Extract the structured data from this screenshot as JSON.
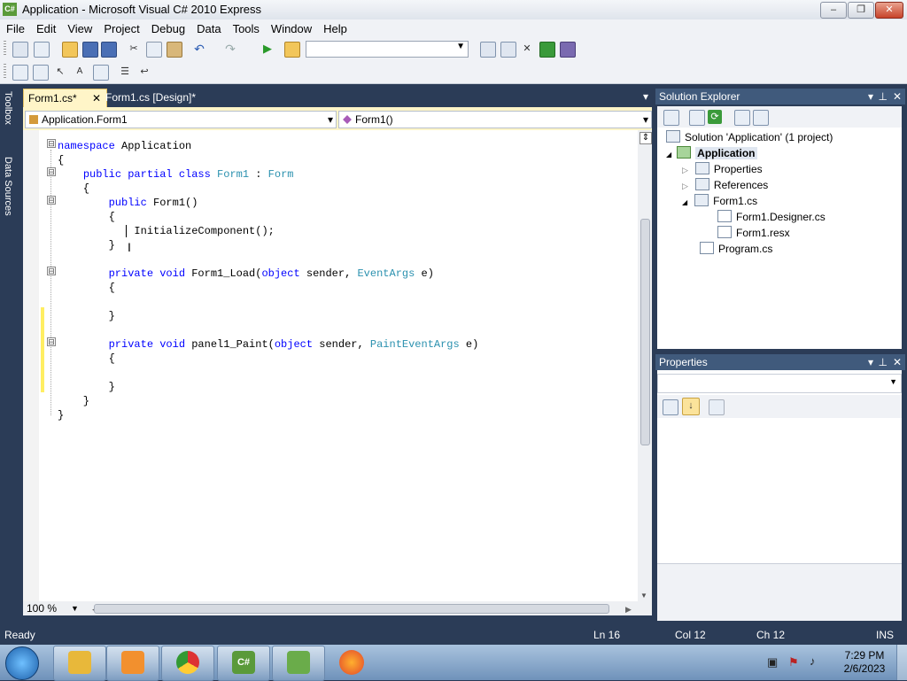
{
  "window": {
    "title": "Application - Microsoft Visual C# 2010 Express",
    "app_icon": "C#",
    "minimize": "–",
    "maximize": "❐",
    "close": "✕"
  },
  "menu": [
    "File",
    "Edit",
    "View",
    "Project",
    "Debug",
    "Data",
    "Tools",
    "Window",
    "Help"
  ],
  "toolbox_tabs": {
    "toolbox": "Toolbox",
    "data_sources": "Data Sources"
  },
  "tabs": [
    {
      "label": "Form1.cs*",
      "close": "✕"
    },
    {
      "label": "Form1.cs [Design]*"
    }
  ],
  "tab_dropdown": "▾",
  "nav": {
    "type_dropdown": "Application.Form1",
    "member_dropdown": "Form1()",
    "arrow": "▾"
  },
  "code_lines": [
    "namespace Application",
    "{",
    "    public partial class Form1 : Form",
    "    {",
    "        public Form1()",
    "        {",
    "            InitializeComponent();",
    "        }",
    "",
    "        private void Form1_Load(object sender, EventArgs e)",
    "        {",
    "",
    "        }",
    "",
    "        private void panel1_Paint(object sender, PaintEventArgs e)",
    "        {",
    "",
    "        }",
    "    }",
    "}"
  ],
  "fold_marks": "⊟",
  "zoom": "100 %",
  "solution_explorer": {
    "title": "Solution Explorer",
    "tree": [
      {
        "label": "Solution 'Application' (1 project)",
        "icon": "solution-icon"
      },
      {
        "label": "Application",
        "icon": "csharp-project-icon",
        "bold": true
      },
      {
        "label": "Properties",
        "icon": "properties-folder-icon"
      },
      {
        "label": "References",
        "icon": "references-folder-icon"
      },
      {
        "label": "Form1.cs",
        "icon": "form-file-icon"
      },
      {
        "label": "Form1.Designer.cs",
        "icon": "cs-file-icon"
      },
      {
        "label": "Form1.resx",
        "icon": "resx-file-icon"
      },
      {
        "label": "Program.cs",
        "icon": "cs-file-icon"
      }
    ],
    "expanders": {
      "open": "◢",
      "closed": "▷"
    }
  },
  "properties_panel": {
    "title": "Properties"
  },
  "panel_buttons": {
    "dropdown": "▾",
    "pin": "⊥",
    "close": "✕"
  },
  "status": {
    "ready": "Ready",
    "line": "Ln 16",
    "col": "Col 12",
    "ch": "Ch 12",
    "mode": "INS"
  },
  "taskbar": {
    "time": "7:29 PM",
    "date": "2/6/2023"
  },
  "colors": {
    "keyword": "#0000ff",
    "type": "#2b91af",
    "chrome": "#2b3c57",
    "active_tab": "#fff5c8"
  }
}
